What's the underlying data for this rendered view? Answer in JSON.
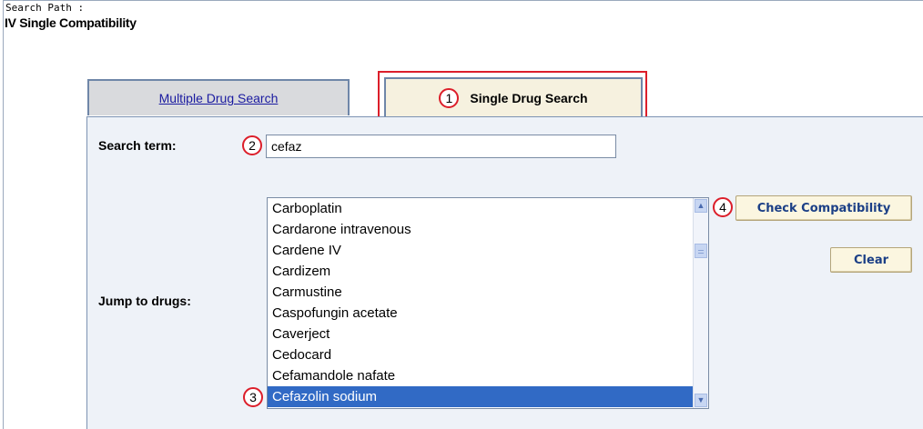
{
  "header": {
    "search_path_label": "Search Path :",
    "search_path_value": "IV Single Compatibility"
  },
  "tabs": {
    "multiple": "Multiple Drug Search",
    "single": "Single Drug Search"
  },
  "form": {
    "search_term_label": "Search term:",
    "search_term_value": "cefaz",
    "jump_label": "Jump to drugs:"
  },
  "drug_list": {
    "items": [
      "Carboplatin",
      "Cardarone intravenous",
      "Cardene IV",
      "Cardizem",
      "Carmustine",
      "Caspofungin acetate",
      "Caverject",
      "Cedocard",
      "Cefamandole nafate",
      "Cefazolin sodium"
    ],
    "selected": "Cefazolin sodium"
  },
  "buttons": {
    "check": "Check Compatibility",
    "clear": "Clear"
  },
  "callouts": [
    "1",
    "2",
    "3",
    "4"
  ],
  "colors": {
    "callout_red": "#dc1e2a",
    "selection_blue": "#316ac5",
    "panel_bg": "#eef2f8",
    "active_tab_bg": "#f6f1df"
  },
  "icons": {
    "scroll_up": "scroll-up-arrow-icon",
    "scroll_down": "scroll-down-arrow-icon"
  }
}
